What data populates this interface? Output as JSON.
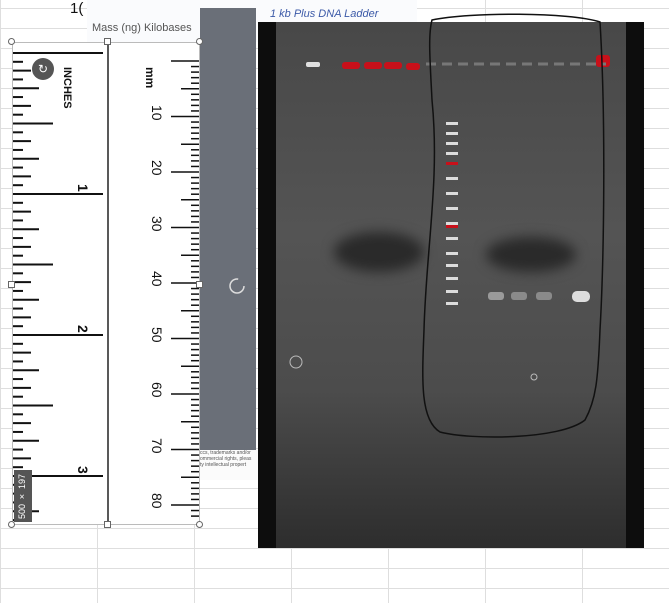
{
  "partial_text": "1(",
  "ladder_doc": {
    "mass_header": "Mass (ng)  Kilobases",
    "title": "1 kb Plus DNA Ladder",
    "footer_lines": [
      "ccs, trademarks and/or",
      "ommercial rights, pleas",
      "ty intellectual propert"
    ]
  },
  "ruler": {
    "units_label": "mm",
    "inches_label": "INCHES",
    "mm_labels": [
      "10",
      "20",
      "30",
      "40",
      "50",
      "60",
      "70",
      "80"
    ],
    "inch_labels": [
      "1",
      "2",
      "3"
    ]
  },
  "selection": {
    "size_badge": "500 × 197"
  },
  "icons": {
    "rotate": "rotate-icon",
    "loading": "spinner-icon"
  }
}
